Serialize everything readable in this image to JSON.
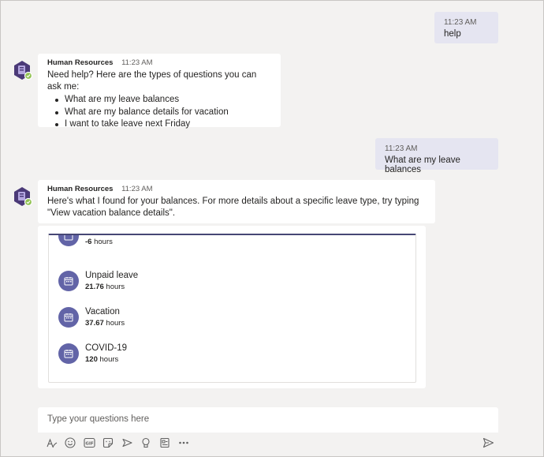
{
  "conversation": {
    "msg1": {
      "time": "11:23 AM",
      "text": "help"
    },
    "bot1": {
      "sender": "Human Resources",
      "time": "11:23 AM",
      "intro": "Need help? Here are the types of questions you can ask me:",
      "options": [
        "What are my leave balances",
        "What are my balance details for vacation",
        "I want to take leave next Friday"
      ]
    },
    "msg2": {
      "time": "11:23 AM",
      "text": "What are my leave balances"
    },
    "bot2": {
      "sender": "Human Resources",
      "time": "11:23 AM",
      "text": "Here's what I found for your balances. For more details about a specific leave type, try typing \"View vacation balance details\"."
    }
  },
  "balances": [
    {
      "name": "",
      "value": "-6",
      "unit": "hours"
    },
    {
      "name": "Unpaid leave",
      "value": "21.76",
      "unit": "hours"
    },
    {
      "name": "Vacation",
      "value": "37.67",
      "unit": "hours"
    },
    {
      "name": "COVID-19",
      "value": "120",
      "unit": "hours"
    }
  ],
  "compose": {
    "placeholder": "Type your questions here"
  },
  "colors": {
    "accent": "#6264a7",
    "my_bubble": "#e5e5f1",
    "background": "#f3f2f1"
  }
}
